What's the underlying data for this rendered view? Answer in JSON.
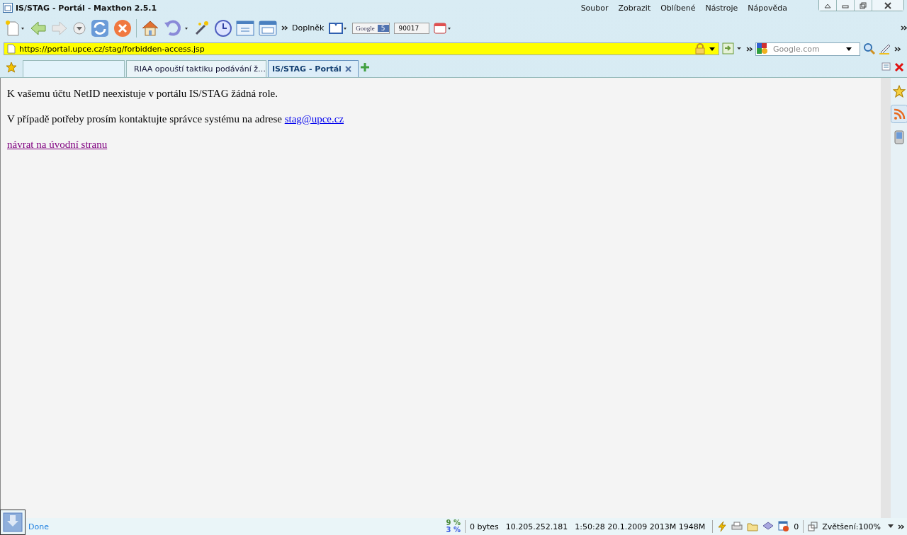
{
  "window": {
    "title": "IS/STAG - Portál - Maxthon 2.5.1"
  },
  "menu": [
    "Soubor",
    "Zobrazit",
    "Oblíbené",
    "Nástroje",
    "Nápověda"
  ],
  "toolbar": {
    "addons_label": "Doplněk",
    "google_label": "Google",
    "google_count": "5",
    "counter": "90017"
  },
  "address": {
    "url": "https://portal.upce.cz/stag/forbidden-access.jsp"
  },
  "search": {
    "placeholder": "Google.com"
  },
  "tabs": [
    {
      "selected": false
    },
    {
      "label": "RIAA opouští taktiku podávání ž…",
      "selected": false
    },
    {
      "label": "IS/STAG - Portál",
      "selected": true
    }
  ],
  "content": {
    "message": "K vašemu účtu NetID neexistuje v portálu IS/STAG žádná role.",
    "contact_text": "V případě potřeby prosím kontaktujte správce systému na adrese",
    "contact_link": "stag@upce.cz",
    "back_link": "návrat na úvodní stranu"
  },
  "status_bar": {
    "text": "Done",
    "cpu": "9 %",
    "net": "3 %",
    "bytes": "0 bytes",
    "ip": "10.205.252.181",
    "time_memory": "1:50:28 20.1.2009 2013M 1948M",
    "blocked_count": "0",
    "zoom": "Zvětšení:100%"
  }
}
